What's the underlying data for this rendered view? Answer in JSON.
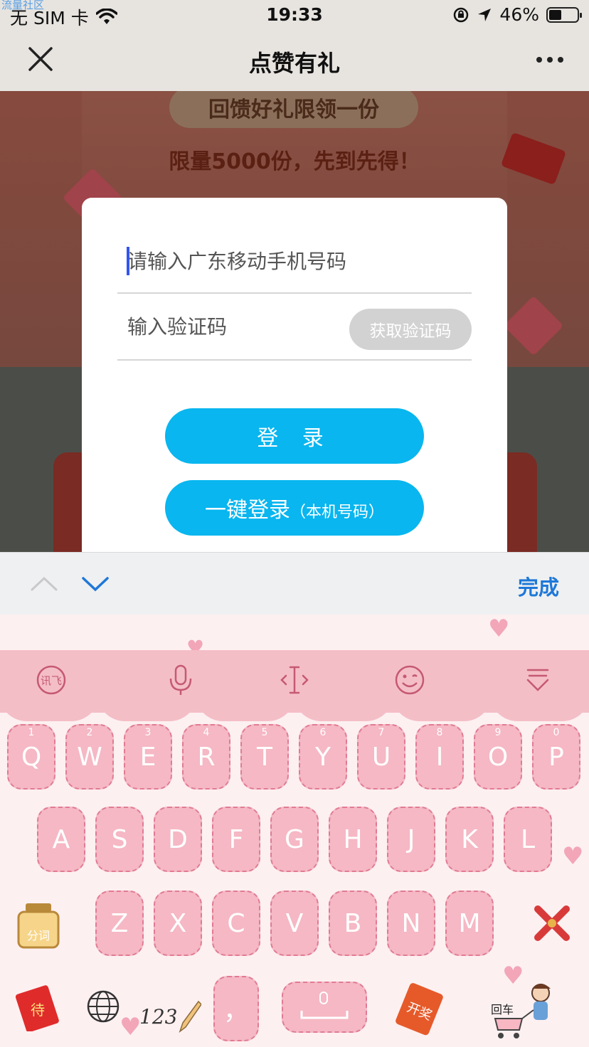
{
  "status_bar": {
    "watermark": "流量社区",
    "carrier": "无 SIM 卡",
    "time": "19:33",
    "battery_percent": "46%",
    "battery_level": 0.46,
    "icons": [
      "wifi-icon",
      "orientation-lock-icon",
      "location-arrow-icon",
      "battery-icon"
    ]
  },
  "nav": {
    "title": "点赞有礼",
    "icons": [
      "close-icon",
      "more-icon"
    ]
  },
  "background_page": {
    "banner": "回馈好礼限领一份",
    "subtitle": "限量5000份，先到先得！"
  },
  "login_modal": {
    "phone_placeholder": "请输入广东移动手机号码",
    "phone_value": "",
    "code_placeholder": "输入验证码",
    "code_value": "",
    "get_code_label": "获取验证码",
    "login_label": "登 录",
    "quick_login_label": "一键登录",
    "quick_login_note": "（本机号码）",
    "colors": {
      "primary": "#09b6ef",
      "disabled": "#d2d2d2",
      "cursor": "#3355ee"
    }
  },
  "accessory_bar": {
    "done_label": "完成",
    "icons": [
      "chevron-up-icon",
      "chevron-down-icon"
    ],
    "done_color": "#1e78d8"
  },
  "keyboard": {
    "toolbar_icons": [
      "ifly-logo-icon",
      "microphone-icon",
      "cursor-move-icon",
      "emoji-icon",
      "hide-keyboard-icon"
    ],
    "toolbar_logo_text": "讯飞",
    "row1": [
      {
        "key": "Q",
        "num": "1"
      },
      {
        "key": "W",
        "num": "2"
      },
      {
        "key": "E",
        "num": "3"
      },
      {
        "key": "R",
        "num": "4"
      },
      {
        "key": "T",
        "num": "5"
      },
      {
        "key": "Y",
        "num": "6"
      },
      {
        "key": "U",
        "num": "7"
      },
      {
        "key": "I",
        "num": "8"
      },
      {
        "key": "O",
        "num": "9"
      },
      {
        "key": "P",
        "num": "0"
      }
    ],
    "row2": [
      "A",
      "S",
      "D",
      "F",
      "G",
      "H",
      "J",
      "K",
      "L"
    ],
    "row3": [
      "Z",
      "X",
      "C",
      "V",
      "B",
      "N",
      "M"
    ],
    "segment_label": "分词",
    "numbers_label": "123",
    "punct_label": "，",
    "enter_label": "回车",
    "red_packet_label": "待",
    "open_label": "开奖",
    "key_color": "#f5b8c4",
    "toolbar_color": "#f4bec7"
  }
}
